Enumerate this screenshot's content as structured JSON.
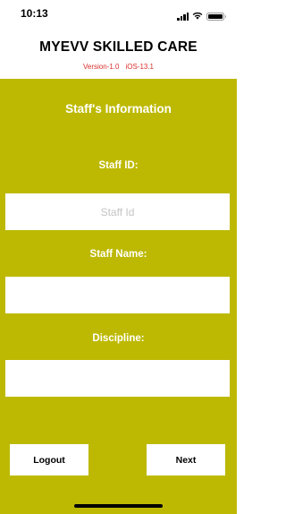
{
  "status_bar": {
    "time": "10:13",
    "icons": [
      "signal-icon",
      "wifi-icon",
      "battery-icon"
    ]
  },
  "header": {
    "title": "MYEVV SKILLED CARE",
    "version": "Version-1.0",
    "os": "iOS-13.1"
  },
  "colors": {
    "panel": "#bdb903",
    "version_text": "#d9302c",
    "button_bg": "#ffffff"
  },
  "form": {
    "title": "Staff's Information",
    "staff_id": {
      "label": "Staff ID:",
      "placeholder": "Staff Id",
      "value": ""
    },
    "staff_name": {
      "label": "Staff Name:",
      "placeholder": "",
      "value": ""
    },
    "discipline": {
      "label": "Discipline:",
      "placeholder": "",
      "value": ""
    }
  },
  "actions": {
    "logout_label": "Logout",
    "next_label": "Next"
  }
}
